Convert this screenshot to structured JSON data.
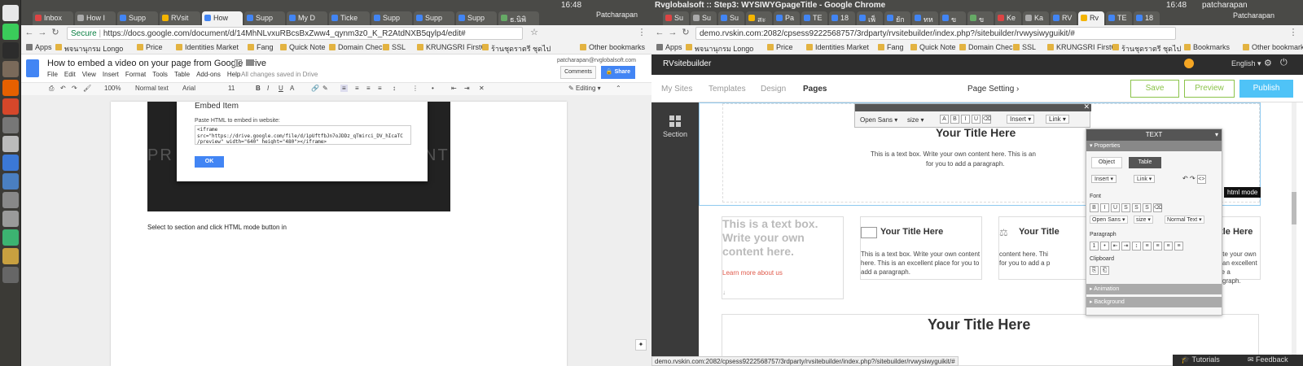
{
  "system": {
    "user": "patcharapan",
    "time": "16:48"
  },
  "launcher": {
    "icons": [
      "chrome-icon",
      "line-icon",
      "terminal-icon",
      "files-icon",
      "firefox-icon",
      "software-icon",
      "text-editor-icon",
      "settings-icon",
      "remote-desktop-icon",
      "vm-icon",
      "camera-icon",
      "audio-icon",
      "app-icon",
      "tools-icon",
      "trash-icon"
    ]
  },
  "left": {
    "tabs": [
      "Inbox",
      "How I",
      "Supp",
      "RVsit",
      "How",
      "Supp",
      "My D",
      "Ticke",
      "Supp",
      "Supp",
      "Supp",
      "ธ.นิพิ"
    ],
    "profile": "Patcharapan",
    "url_secure": "Secure",
    "url": "https://docs.google.com/document/d/14MhNLvxuRBcsBxZww4_qynm3z0_K_R2AtdNXB5qylp4/edit#",
    "bookmarks": [
      "Apps",
      "พจนานุกรม Longo",
      "Price",
      "Identities Market",
      "Fang",
      "Quick Note",
      "Domain Check",
      "SSL",
      "KRUNGSRI FirstCl",
      "ร้านชุดราตรี ชุดไป",
      "Other bookmarks"
    ],
    "doc": {
      "title": "How to embed a video on your page from Google Drive",
      "account": "patcharapan@rvglobalsoft.com",
      "menu": [
        "File",
        "Edit",
        "View",
        "Insert",
        "Format",
        "Tools",
        "Table",
        "Add-ons",
        "Help"
      ],
      "saved": "All changes saved in Drive",
      "comments": "Comments",
      "share": "Share",
      "toolbar": {
        "zoom": "100%",
        "style": "Normal text",
        "font": "Arial",
        "size": "11",
        "mode": "Editing"
      },
      "dialog": {
        "title": "Embed Item",
        "label": "Paste HTML to embed in website:",
        "code": "<iframe\nsrc=\"https://drive.google.com/file/d/1pUftfbJn7oJDDz_qTmirci_DV_hIcaTC\n/preview\" width=\"640\" height=\"480\"></iframe>",
        "ok": "OK"
      },
      "video_text": "PR",
      "video_text_right": "NT",
      "body_text": "Select to section and click HTML mode button in"
    }
  },
  "right": {
    "window_title": "Rvglobalsoft :: Step3: WYSIWYGpageTitle - Google Chrome",
    "tabs": [
      "Su",
      "Su",
      "Su",
      "สะ",
      "Pa",
      "TE",
      "18",
      "เพ็",
      "ยัก",
      "ทห",
      "ข",
      "ข",
      "Ke",
      "Ka",
      "RV",
      "Rv",
      "TE",
      "18"
    ],
    "profile": "Patcharapan",
    "url": "demo.rvskin.com:2082/cpsess9222568757/3rdparty/rvsitebuilder/index.php?/sitebuilder/rvwysiwyguikit/#",
    "bookmarks": [
      "Apps",
      "พจนานุกรม Longo",
      "Price",
      "Identities Market",
      "Fang",
      "Quick Note",
      "Domain Check",
      "SSL",
      "KRUNGSRI FirstCl",
      "ร้านชุดราตรี ชุดไป",
      "Bookmarks",
      "Other bookmarks"
    ],
    "app": {
      "brand": "RVsitebuilder",
      "language": "English",
      "nav": [
        "My Sites",
        "Templates",
        "Design",
        "Pages"
      ],
      "page_setting": "Page Setting",
      "save": "Save",
      "preview": "Preview",
      "publish": "Publish",
      "section_label": "Section",
      "editor_bar": {
        "font": "Open Sans",
        "size": "size",
        "insert": "Insert",
        "link": "Link"
      },
      "hero_title": "Your Title Here",
      "hero_text": "This is a text box. Write your own content here. This is an",
      "hero_text2": "for you to add a paragraph.",
      "card_big_text": "This is a text box. Write your own content here.",
      "card_link": "Learn more about us",
      "card_title": "Your Title Here",
      "card_title_partial": "Your Title",
      "card_title_partial2": "itle Here",
      "card_text": "This is a text box. Write your own content here. This is an excellent place for you to add a paragraph.",
      "card_text_partial": "content here. Thi for you to add a p",
      "card_text_right": ". Write your own is is an excellent place a paragraph.",
      "bottom_title": "Your Title Here",
      "panel": {
        "header": "TEXT",
        "properties": "Properties",
        "tab_object": "Object",
        "tab_table": "Table",
        "insert": "Insert",
        "link": "Link",
        "font_label": "Font",
        "font": "Open Sans",
        "size": "size",
        "normal": "Normal Text",
        "paragraph_label": "Paragraph",
        "clipboard_label": "Clipboard",
        "animation": "Animation",
        "background": "Background"
      },
      "tooltip": "html mode",
      "tutorials": "Tutorials",
      "feedback": "Feedback",
      "status_url": "demo.rvskin.com:2082/cpsess9222568757/3rdparty/rvsitebuilder/index.php?/sitebuilder/rvwysiwyguikit/#"
    }
  },
  "colors": {
    "accent_green": "#8bc34a",
    "publish_blue": "#4fc3f7",
    "docs_blue": "#4285f4",
    "link_red": "#e05a4b"
  }
}
